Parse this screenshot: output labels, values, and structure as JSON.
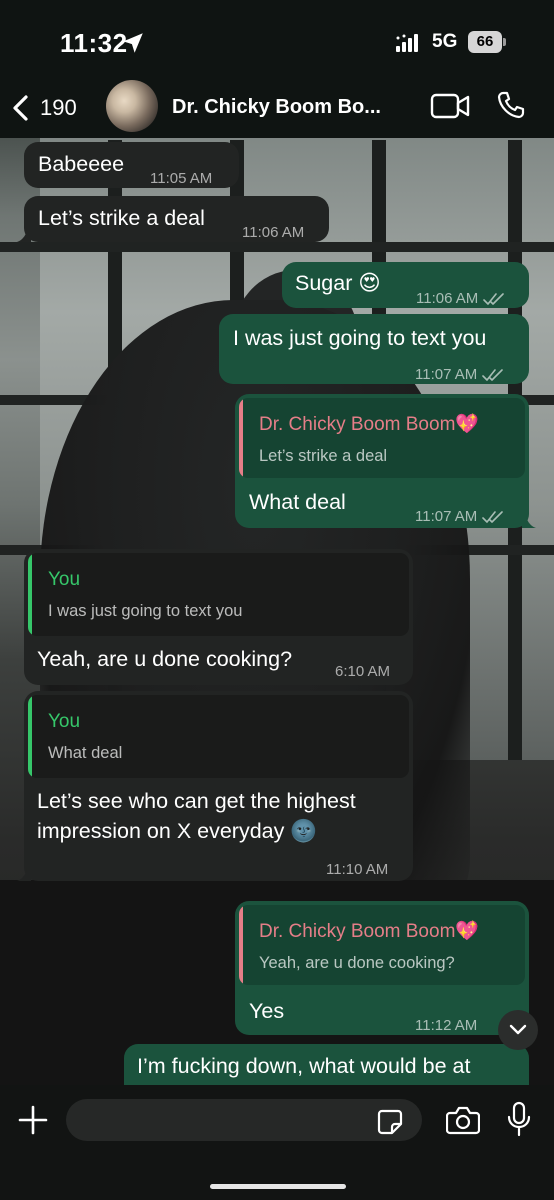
{
  "status_bar": {
    "time": "11:32",
    "network": "5G",
    "battery": "66"
  },
  "header": {
    "back_count": "190",
    "contact_name": "Dr. Chicky Boom Bo..."
  },
  "messages": [
    {
      "direction": "in",
      "text": "Babeeee",
      "time": "11:05 AM"
    },
    {
      "direction": "in",
      "text": "Let’s strike a deal",
      "time": "11:06 AM"
    },
    {
      "direction": "out",
      "text": "Sugar 😍",
      "time": "11:06 AM"
    },
    {
      "direction": "out",
      "text": "I was just going to text you",
      "time": "11:07 AM"
    },
    {
      "direction": "out",
      "quote_author": "Dr. Chicky Boom Boom💖",
      "quote_text": "Let’s strike a deal",
      "text": "What deal",
      "time": "11:07 AM"
    },
    {
      "direction": "in",
      "quote_author": "You",
      "quote_text": "I was just going to text you",
      "text": "Yeah, are u done cooking?",
      "time": "6:10 AM"
    },
    {
      "direction": "in",
      "quote_author": "You",
      "quote_text": "What deal",
      "text_line1": "Let’s see who can get the highest",
      "text_line2": "impression on X everyday 🌚",
      "time": "11:10 AM"
    },
    {
      "direction": "out",
      "quote_author": "Dr. Chicky Boom Boom💖",
      "quote_text": "Yeah, are u done cooking?",
      "text": "Yes",
      "time": "11:12 AM"
    },
    {
      "direction": "out",
      "text": "I’m fucking down, what would be at"
    }
  ],
  "composer": {
    "placeholder": ""
  },
  "colors": {
    "outgoing_bubble": "#1b533d",
    "incoming_bubble": "#222423",
    "quote_author_contact": "#e57e88",
    "quote_author_you": "#36c76a",
    "quote_bar_contact": "#e57e88",
    "quote_bar_you": "#36c76a"
  },
  "icons": [
    "location-arrow-icon",
    "signal-icon",
    "back-chevron-icon",
    "video-call-icon",
    "phone-call-icon",
    "read-ticks-icon",
    "chevron-down-icon",
    "plus-icon",
    "sticker-icon",
    "camera-icon",
    "microphone-icon"
  ]
}
